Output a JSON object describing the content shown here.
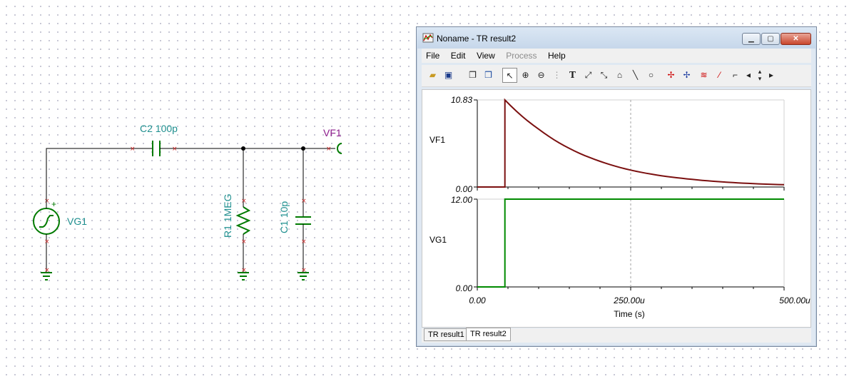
{
  "schematic": {
    "source": {
      "name": "VG1",
      "polarity": "+"
    },
    "c2": {
      "label": "C2 100p"
    },
    "r1": {
      "label": "R1 1MEG"
    },
    "c1": {
      "label": "C1 10p"
    },
    "output": {
      "label": "VF1"
    },
    "colors": {
      "component": "#007a00",
      "label": "#1f8f8f",
      "node": "#8b1a8b",
      "wire": "#000000"
    }
  },
  "window": {
    "title": "Noname - TR result2",
    "menu": [
      {
        "label": "File",
        "enabled": true
      },
      {
        "label": "Edit",
        "enabled": true
      },
      {
        "label": "View",
        "enabled": true
      },
      {
        "label": "Process",
        "enabled": false
      },
      {
        "label": "Help",
        "enabled": true
      }
    ],
    "toolbar_icons": [
      "open-folder-icon",
      "save-icon",
      "copy-icon",
      "paste-icon",
      "pointer-icon",
      "zoom-in-icon",
      "zoom-100-icon",
      "grid-icon",
      "text-icon",
      "curve-label-icon",
      "curve-label-2-icon",
      "legend-icon",
      "line-icon",
      "circle-icon",
      "cursor-a-icon",
      "cursor-b-icon",
      "curves-icon",
      "marker-icon",
      "cursor-icon",
      "prev-icon",
      "up-down-icon",
      "next-icon"
    ],
    "tabs": [
      {
        "label": "TR result1",
        "active": false
      },
      {
        "label": "TR result2",
        "active": true
      }
    ]
  },
  "chart_data": {
    "type": "line",
    "xlabel": "Time (s)",
    "xlim": [
      0,
      0.0005
    ],
    "x_ticks": [
      "0.00",
      "250.00u",
      "500.00u"
    ],
    "grid": "dashed vertical line at 250.00u",
    "panels": [
      {
        "name": "VF1",
        "color": "#7b1010",
        "ylim": [
          0,
          10.83
        ],
        "y_ticks": [
          "0.00",
          "10.83"
        ],
        "points": [
          [
            0,
            0
          ],
          [
            4.5e-05,
            0
          ],
          [
            4.5e-05,
            10.83
          ],
          [
            0.0001,
            7.2
          ],
          [
            0.00015,
            4.8
          ],
          [
            0.0002,
            3.2
          ],
          [
            0.00025,
            2.1
          ],
          [
            0.0003,
            1.4
          ],
          [
            0.00035,
            0.95
          ],
          [
            0.0004,
            0.63
          ],
          [
            0.00045,
            0.42
          ],
          [
            0.0005,
            0.28
          ]
        ]
      },
      {
        "name": "VG1",
        "color": "#008a00",
        "ylim": [
          0,
          12
        ],
        "y_ticks": [
          "0.00",
          "12.00"
        ],
        "points": [
          [
            0,
            0
          ],
          [
            4.5e-05,
            0
          ],
          [
            4.5e-05,
            12
          ],
          [
            0.0005,
            12
          ]
        ]
      }
    ]
  }
}
